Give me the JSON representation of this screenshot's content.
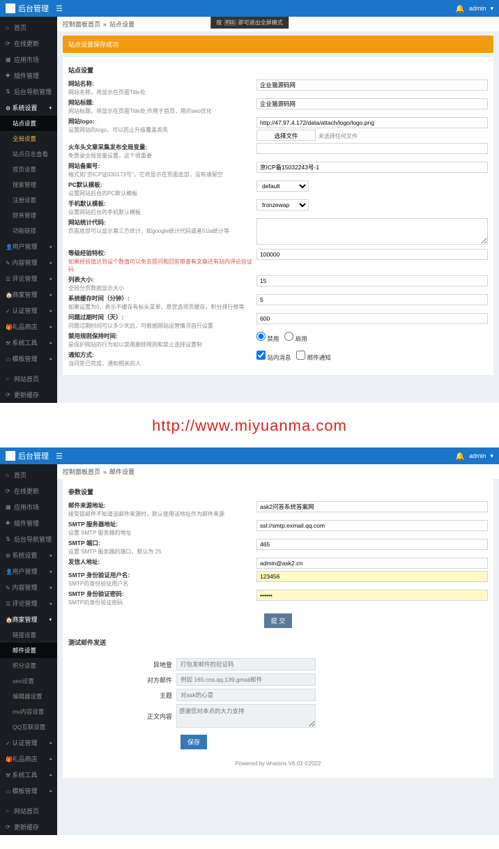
{
  "topbar": {
    "title": "后台管理",
    "user": "admin",
    "bell": "🔔"
  },
  "sidebar": {
    "a": [
      {
        "ico": "⌂",
        "label": "首页"
      },
      {
        "ico": "⟳",
        "label": "在线更新"
      },
      {
        "ico": "▦",
        "label": "应用市场"
      },
      {
        "ico": "✚",
        "label": "插件管理"
      },
      {
        "ico": "⇅",
        "label": "后台导航管理"
      }
    ],
    "sys": {
      "ico": "⚙",
      "label": "系统设置"
    },
    "sys_sub": [
      {
        "label": "站点设置",
        "cur": true
      },
      {
        "label": "全局设置",
        "hl": true
      },
      {
        "label": "站点日志查看"
      },
      {
        "label": "首页设置"
      },
      {
        "label": "搜索管理"
      },
      {
        "label": "注册设置"
      },
      {
        "label": "财务管理"
      },
      {
        "label": "功能链接"
      }
    ],
    "b": [
      {
        "ico": "👤",
        "label": "用户管理"
      },
      {
        "ico": "✎",
        "label": "内容管理"
      },
      {
        "ico": "☰",
        "label": "评论管理"
      },
      {
        "ico": "🏠",
        "label": "商家管理"
      },
      {
        "ico": "✓",
        "label": "认证管理"
      },
      {
        "ico": "🎁",
        "label": "礼品商店"
      },
      {
        "ico": "⚒",
        "label": "系统工具"
      },
      {
        "ico": "▭",
        "label": "模板管理"
      }
    ],
    "c": [
      {
        "ico": "○",
        "label": "网站首页"
      },
      {
        "ico": "⟳",
        "label": "更新缓存"
      }
    ],
    "b2": [
      {
        "ico": "⚙",
        "label": "系统设置"
      },
      {
        "ico": "👤",
        "label": "用户管理"
      },
      {
        "ico": "✎",
        "label": "内容管理"
      },
      {
        "ico": "☰",
        "label": "评论管理"
      }
    ],
    "shop": {
      "ico": "🏠",
      "label": "商家管理"
    },
    "shop_sub": [
      {
        "label": "链接设置"
      },
      {
        "label": "邮件设置",
        "cur2": true
      },
      {
        "label": "积分设置"
      },
      {
        "label": "seo设置"
      },
      {
        "label": "编辑器设置"
      },
      {
        "label": "mv内容设置"
      },
      {
        "label": "QQ互联设置"
      }
    ]
  },
  "crumb1": {
    "a": "控制面板首页",
    "b": "站点设置"
  },
  "crumb2": {
    "a": "控制面板首页",
    "b": "邮件设置"
  },
  "f11": {
    "a": "按",
    "b": "F11",
    "c": "即可退出全屏模式"
  },
  "alert": "站点设置保存成功",
  "sect1": "站点设置",
  "rows1": [
    {
      "l1": "网站名称:",
      "l2": "网站名称，将显示在页面Title处",
      "val": "企业猫源码网"
    },
    {
      "l1": "网站标题:",
      "l2": "网站标题，将显示在页面Title处,作用于首页，用的seo优化",
      "val": "企业猫源码网"
    },
    {
      "l1": "网站logo:",
      "l2": "设置网站的logo，可以防止升级覆盖丢失",
      "val": "http://47.97.4.172/data/attach/logo/logo.png",
      "file": "选择文件",
      "filehint": "未选择任何文件"
    },
    {
      "l1": "火车头文章采集发布全局变量:",
      "l2": "免登录全局变量设置，这个很重要",
      "val": ""
    },
    {
      "l1": "网站备案号:",
      "l2": "格式如\"京ICP证030173号\"，它将显示在页面底部，没有请留空",
      "val": "京ICP备15032243号-1"
    },
    {
      "l1": "PC默认模板:",
      "l2": "设置网站后台的PC默认模板",
      "sel": "default"
    },
    {
      "l1": "手机默认模板:",
      "l2": "设置网站后台的手机默认模板",
      "sel": "fronzewap"
    },
    {
      "l1": "网站统计代码:",
      "l2": "页面底部可以显示第三方统计，如google统计代码或者51la统计等",
      "ta": true
    },
    {
      "l1": "等级经验特权:",
      "l2": "如果经验值达到设个数值可以免去提问和回答审查有文章还有站内评论验证码",
      "warn": true,
      "val": "100000"
    },
    {
      "l1": "列表大小:",
      "l2": "全局分页数据显示大小",
      "val": "15"
    },
    {
      "l1": "系统缓存时间（分钟）:",
      "l2": "如果设置为0，表示不缓存有标头菜单，悬赏选项页缓存，积分排行榜等",
      "val": "5"
    },
    {
      "l1": "问题过期时间（天）:",
      "l2": "问题过期时间可以多少天后，可根据网站运营情况自行设置",
      "val": "600"
    },
    {
      "l1": "禁用规则保持时间:",
      "l2": "是保护网站的行为知以禁用删除规则和禁止选择设置制",
      "radio": true,
      "r1": "禁用",
      "r2": "启用"
    },
    {
      "l1": "通知方式:",
      "l2": "当问答已完成，通知相关的人",
      "check": true,
      "c1": "站内消息",
      "c2": "邮件通知"
    }
  ],
  "sect2": "参数设置",
  "rows2": [
    {
      "l1": "邮件来源地址:",
      "l2": "接受提邮件不知道该邮件来源时，默认使用该地址作为邮件来源",
      "val": "ask2问答系统答案网"
    },
    {
      "l1": "SMTP 服务器地址:",
      "l2": "设置 SMTP 服务器的地址",
      "val": "ssl://smtp.exmail.qq.com"
    },
    {
      "l1": "SMTP 端口:",
      "l2": "设置 SMTP 服务器的端口，默认为 25",
      "val": "465"
    },
    {
      "l1": "发信人地址:",
      "l2": "",
      "val": "admin@ask2.cn"
    },
    {
      "l1": "SMTP 身份验证用户名:",
      "l2": "SMTP的身份验证用户名",
      "val": "123456",
      "hl": true
    },
    {
      "l1": "SMTP 身份验证密码:",
      "l2": "SMTP的身份验证密码",
      "val": "••••••",
      "hl": true
    }
  ],
  "submit": "提 交",
  "test_title": "测试邮件发送",
  "test": [
    {
      "lab": "异地登",
      "ph": "打包发邮件的验证码"
    },
    {
      "lab": "对方邮件",
      "ph": "例如 165.cns.qq,139.gmail邮件"
    },
    {
      "lab": "主题",
      "ph": "对ask的心意"
    },
    {
      "lab": "正文内容",
      "ph": "感谢您对本点的大力支持",
      "ta": true
    }
  ],
  "save": "保存",
  "footer": "Powered by whatsns V6.03 ©2022",
  "watermark": "http://www.miyuanma.com"
}
